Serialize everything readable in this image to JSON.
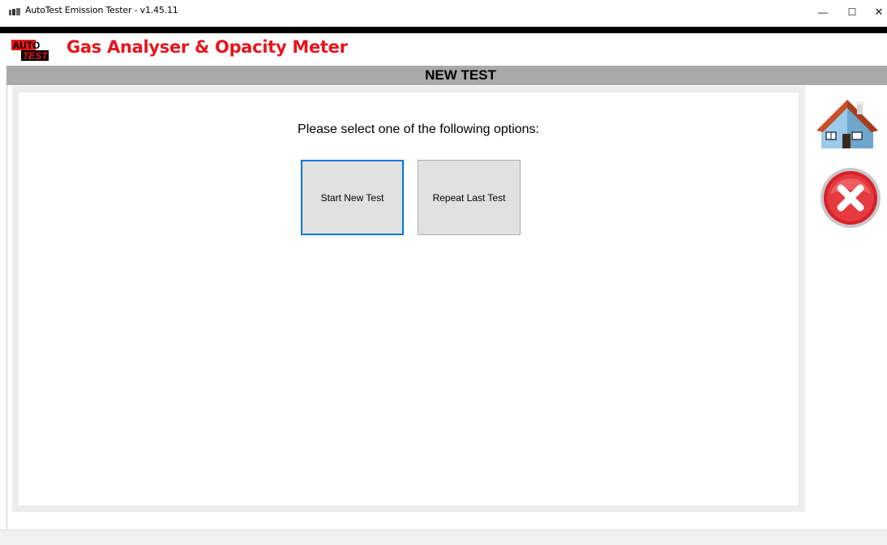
{
  "window": {
    "title": "AutoTest Emission Tester - v1.45.11",
    "controls": {
      "minimize": "—",
      "maximize": "☐",
      "close": "✕"
    }
  },
  "header": {
    "logo": {
      "line1": "AUTO",
      "line2": "TEST"
    },
    "app_title": "Gas Analyser & Opacity Meter",
    "accent_color": "#e5161d"
  },
  "section": {
    "title": "NEW TEST"
  },
  "main": {
    "prompt": "Please select one of the following options:",
    "options": [
      {
        "label": "Start New Test",
        "focused": true
      },
      {
        "label": "Repeat Last Test",
        "focused": false
      }
    ]
  },
  "sidebar": {
    "buttons": [
      {
        "icon": "home-icon"
      },
      {
        "icon": "cancel-icon"
      }
    ]
  }
}
